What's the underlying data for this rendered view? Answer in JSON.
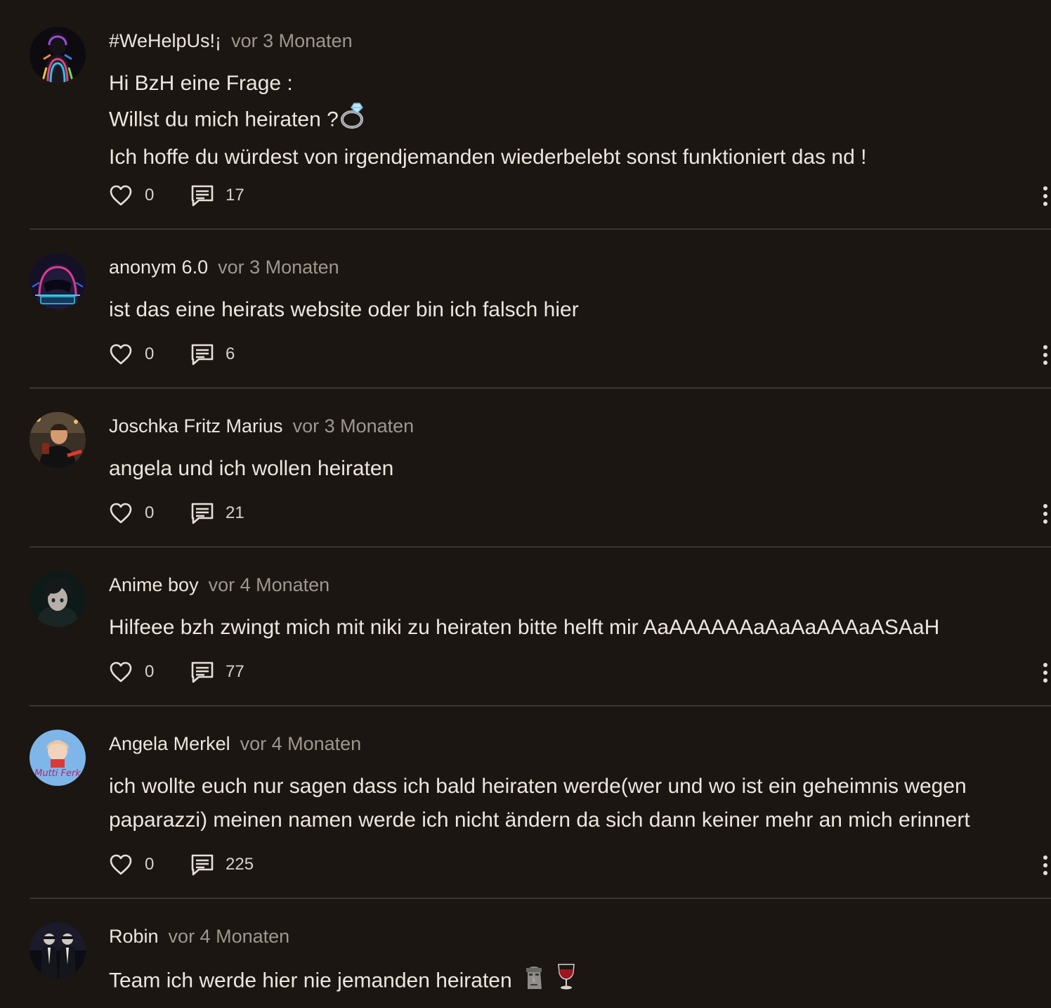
{
  "comments": [
    {
      "author": "#WeHelpUs!¡",
      "time": "vor 3 Monaten",
      "lines": [
        "Hi BzH eine Frage :",
        "Willst du mich heiraten ?",
        "Ich hoffe du würdest von irgendjemanden wiederbelebt sonst funktioniert das nd !"
      ],
      "likes": "0",
      "replies": "17",
      "avatar": "hooded-neon-figure"
    },
    {
      "author": "anonym 6.0",
      "time": "vor 3 Monaten",
      "lines": [
        "ist das eine heirats website oder bin ich falsch hier"
      ],
      "likes": "0",
      "replies": "6",
      "avatar": "neon-hacker-hood"
    },
    {
      "author": "Joschka Fritz Marius",
      "time": "vor 3 Monaten",
      "lines": [
        "angela und ich wollen heiraten"
      ],
      "likes": "0",
      "replies": "21",
      "avatar": "man-with-glass"
    },
    {
      "author": "Anime boy",
      "time": "vor 4 Monaten",
      "lines": [
        "Hilfeee bzh zwingt mich mit niki zu heiraten bitte helft mir AaAAAAAAaAaAaAAAaASAaH"
      ],
      "likes": "0",
      "replies": "77",
      "avatar": "anime-character"
    },
    {
      "author": "Angela Merkel",
      "time": "vor 4 Monaten",
      "lines": [
        "ich wollte euch nur sagen dass ich bald heiraten werde(wer und wo ist ein geheimnis wegen",
        "paparazzi) meinen namen werde ich nicht ändern da sich dann keiner mehr an mich erinnert"
      ],
      "likes": "0",
      "replies": "225",
      "avatar": "mutti-cartoon",
      "avatar_text": "Mutti Ferk"
    },
    {
      "author": "Robin",
      "time": "vor 4 Monaten",
      "lines": [
        "Team ich werde hier nie jemanden heiraten"
      ],
      "avatar": "two-men-in-suits"
    }
  ],
  "icons": {
    "like": "heart-outline-icon",
    "reply": "comment-bubble-icon",
    "more": "vertical-dots-icon",
    "ring": "ring-emoji",
    "moai": "moai-emoji",
    "wine": "wine-glass-emoji"
  },
  "colors": {
    "background": "#1b1612",
    "text": "#ece6dc",
    "muted": "#9e978c",
    "divider": "#3b3530"
  }
}
